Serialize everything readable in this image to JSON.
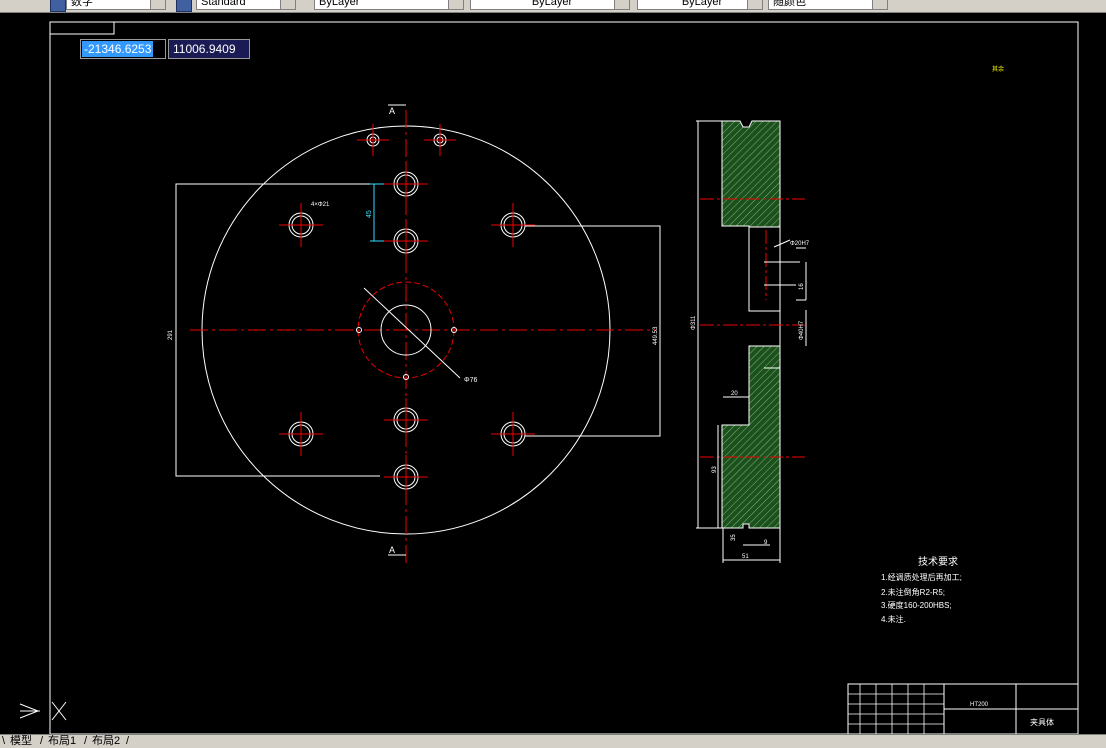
{
  "toolbar": {
    "combo1": "数字",
    "combo2": "Standard",
    "combo3": "ByLayer",
    "combo4": "ByLayer",
    "combo5": "ByLayer",
    "combo6": "随颜色"
  },
  "coords": {
    "x": "-21346.6253",
    "y": "11006.9409"
  },
  "drawing": {
    "section_mark_top": "A",
    "section_mark_bottom": "A",
    "dim_45": "45",
    "dim_left_vertical": "291",
    "dim_right_vertical": "449.53",
    "dim_hole_note": "4×Φ21",
    "dim_center_dia": "Φ76",
    "roughness_top_right": "其余",
    "tech_title": "技术要求",
    "tech_items": [
      "1.经调质处理后再加工;",
      "2.未注倒角R2-R5;",
      "3.硬度160-200HBS;",
      "4.未注."
    ],
    "side_dims": {
      "d1": "Φ311",
      "d2": "Φ20H7",
      "d3": "Φ40H7",
      "d4": "20",
      "d5": "93",
      "d6": "51",
      "d7": "35",
      "d8": "9",
      "d9": "16"
    },
    "title_block": {
      "material": "HT200",
      "part_name": "夹具体"
    }
  },
  "tabs": {
    "model": "模型",
    "layout1": "布局1",
    "layout2": "布局2"
  }
}
